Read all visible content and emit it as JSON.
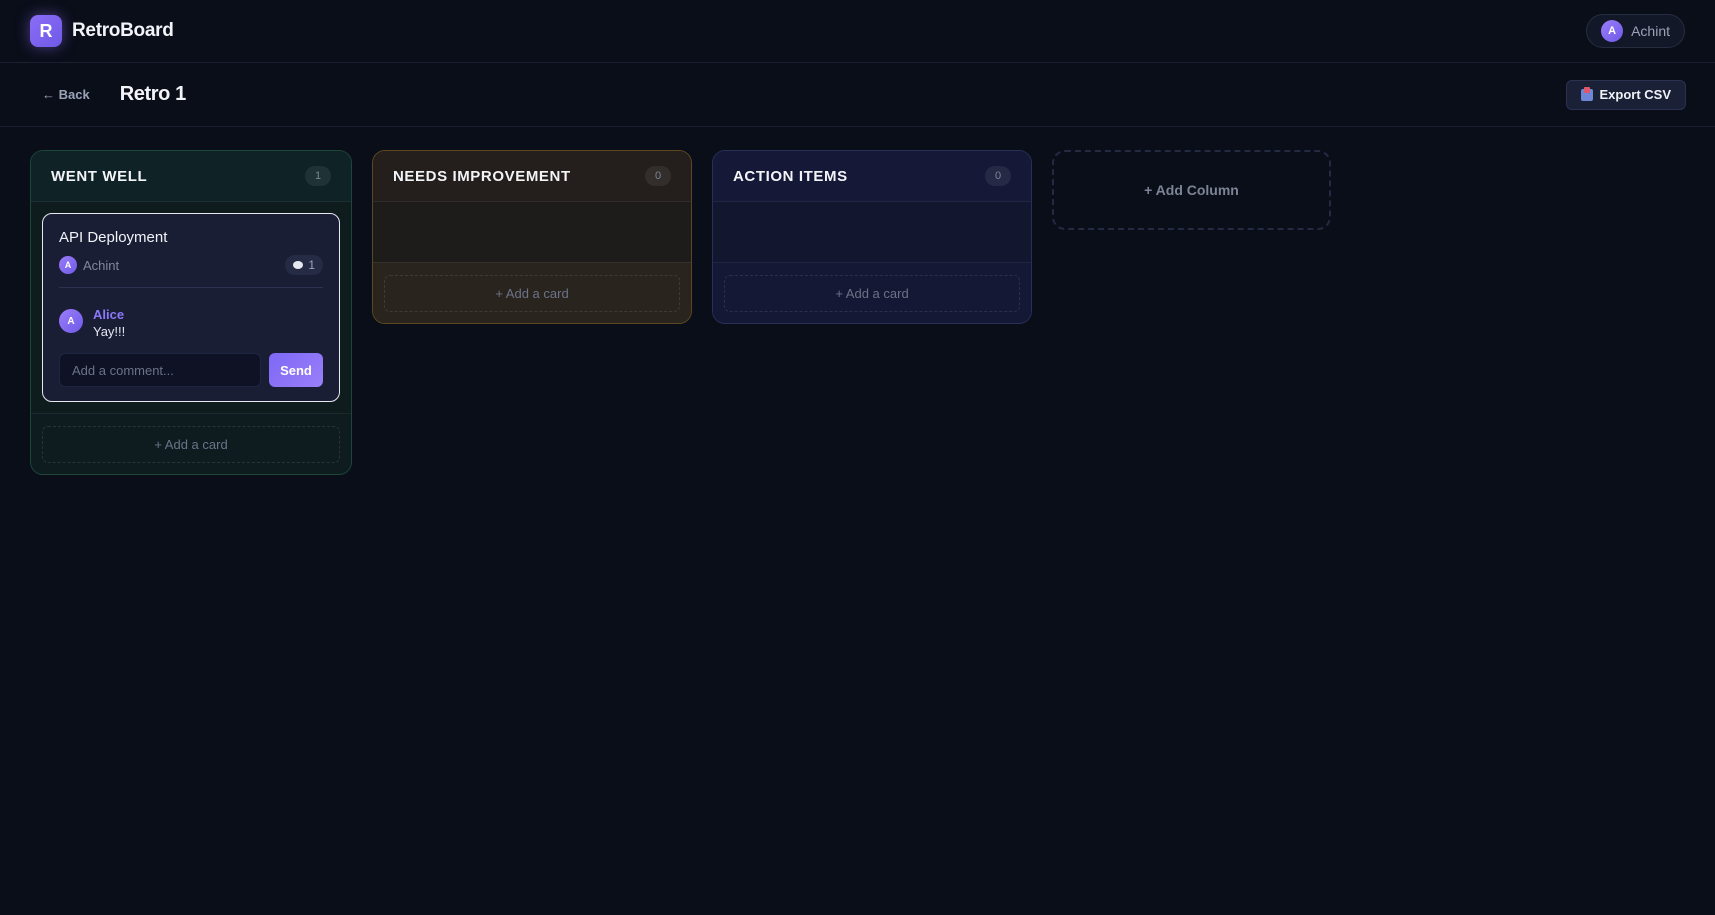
{
  "app": {
    "logo_letter": "R",
    "name": "RetroBoard"
  },
  "user": {
    "initial": "A",
    "name": "Achint"
  },
  "subbar": {
    "back_label": "← Back",
    "title": "Retro 1",
    "export_label": "Export CSV"
  },
  "columns": [
    {
      "title": "WENT WELL",
      "count": "1",
      "color": "#1d4638",
      "cards": [
        {
          "title": "API Deployment",
          "author_initial": "A",
          "author": "Achint",
          "comment_count": "1",
          "comments": [
            {
              "initial": "A",
              "author": "Alice",
              "text": "Yay!!!"
            }
          ],
          "comment_placeholder": "Add a comment...",
          "send_label": "Send"
        }
      ],
      "add_card_label": "+ Add a card"
    },
    {
      "title": "NEEDS IMPROVEMENT",
      "count": "0",
      "color": "#5c4820",
      "add_card_label": "+ Add a card"
    },
    {
      "title": "ACTION ITEMS",
      "count": "0",
      "color": "#2b2f58",
      "add_card_label": "+ Add a card"
    }
  ],
  "add_column_label": "+ Add Column",
  "colors": {
    "background": "#0a0e19",
    "accent": "#8b6cf6"
  }
}
